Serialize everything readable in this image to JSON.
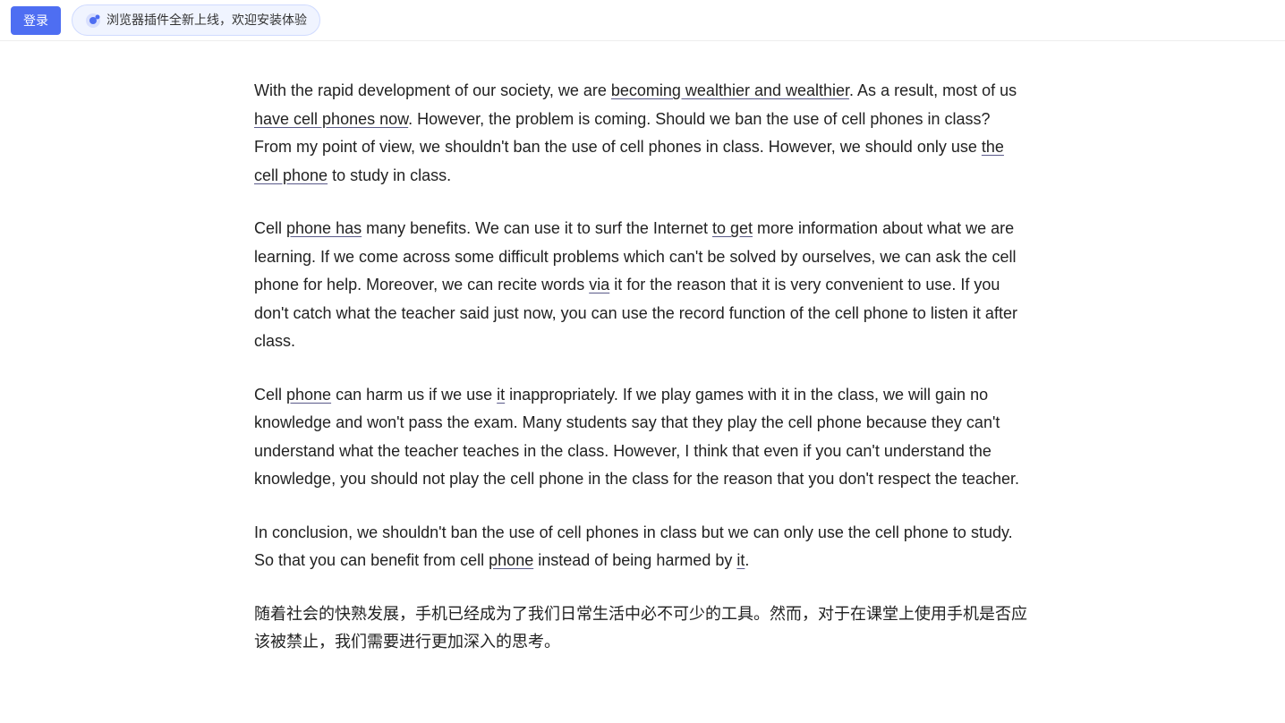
{
  "topbar": {
    "login_label": "登录",
    "plugin_text": "浏览器插件全新上线，欢迎安装体验"
  },
  "paragraphs": [
    {
      "id": "para1",
      "text_parts": [
        {
          "text": "With the rapid development of our society, we are ",
          "type": "normal"
        },
        {
          "text": "becoming wealthier and wealthier",
          "type": "underline"
        },
        {
          "text": ". As a result, most of us ",
          "type": "normal"
        },
        {
          "text": "have cell phones now",
          "type": "underline"
        },
        {
          "text": ". However, the problem is coming. Should we ban the use of cell phones in class? From my point of view, we shouldn’t ban the use of cell phones in class. However, we should only use ",
          "type": "normal"
        },
        {
          "text": "the cell phone",
          "type": "underline"
        },
        {
          "text": " to study in class.",
          "type": "normal"
        }
      ]
    },
    {
      "id": "para2",
      "text_parts": [
        {
          "text": "Cell ",
          "type": "normal"
        },
        {
          "text": "phone has",
          "type": "underline"
        },
        {
          "text": " many benefits. We can use it to surf the Internet ",
          "type": "normal"
        },
        {
          "text": "to get",
          "type": "underline"
        },
        {
          "text": " more information about what we are learning. If we come across some difficult problems which can’t be solved by ourselves, we can ask the cell phone for help. Moreover, we can recite words ",
          "type": "normal"
        },
        {
          "text": "via",
          "type": "underline"
        },
        {
          "text": " it for the reason that it is very convenient to use. If you don’t catch what the teacher said just now, you can use the record function of the cell phone to listen it after class.",
          "type": "normal"
        }
      ]
    },
    {
      "id": "para3",
      "text_parts": [
        {
          "text": "Cell ",
          "type": "normal"
        },
        {
          "text": "phone",
          "type": "underline"
        },
        {
          "text": " can harm us if we use ",
          "type": "normal"
        },
        {
          "text": "it",
          "type": "underline"
        },
        {
          "text": " inappropriately. If we play games with it in the class, we will gain no knowledge and won’t pass the exam. Many students say that they play the cell phone because they can’t understand what the teacher teaches in the class. However, I think that even if you can’t understand the knowledge, you should not play the cell phone in the class for the reason that you don’t respect the teacher.",
          "type": "normal"
        }
      ]
    },
    {
      "id": "para4",
      "text_parts": [
        {
          "text": "In conclusion, we shouldn’t ban the use of cell phones in class but we can only use the cell phone to study. So that you can benefit from cell ",
          "type": "normal"
        },
        {
          "text": "phone",
          "type": "underline"
        },
        {
          "text": " instead of being harmed by ",
          "type": "normal"
        },
        {
          "text": "it",
          "type": "underline"
        },
        {
          "text": ".",
          "type": "normal"
        }
      ]
    },
    {
      "id": "para5",
      "text_parts": [
        {
          "text": "随着社会的快熟发展，手机已经成为了我们日常生活中必不可少的工具。然而，对于在课堂上使用手机是否应该被禁止，我们需要进行更加深入的思考。",
          "type": "chinese"
        }
      ]
    }
  ]
}
